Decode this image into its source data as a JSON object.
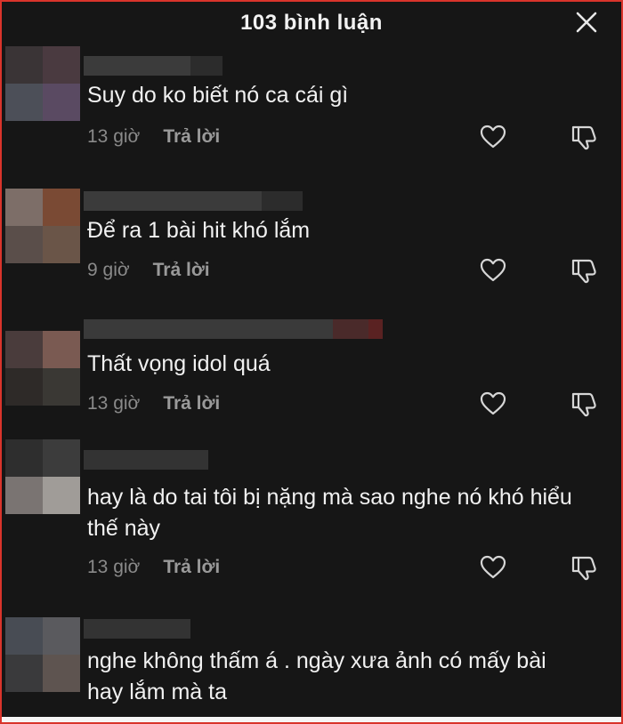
{
  "header": {
    "title": "103 bình luận",
    "close_icon": "close-icon"
  },
  "comments": [
    {
      "text": "Suy do ko biết nó ca cái gì",
      "time": "13 giờ",
      "reply": "Trả lời"
    },
    {
      "text": "Để ra 1 bài hit khó lắm",
      "time": "9 giờ",
      "reply": "Trả lời"
    },
    {
      "text": "Thất vọng idol quá",
      "time": "13 giờ",
      "reply": "Trả lời"
    },
    {
      "text": "hay là do tai tôi bị nặng mà sao nghe nó khó hiểu thế này",
      "time": "13 giờ",
      "reply": "Trả lời"
    },
    {
      "text": "nghe không thấm á . ngày xưa ảnh có mấy bài hay lắm mà ta"
    }
  ],
  "icons": {
    "like": "heart-icon",
    "dislike": "thumbs-down-icon"
  },
  "colors": {
    "background": "#161616",
    "text": "#f1f1f1",
    "meta": "#8a8a8a",
    "frame_border": "#d9342b"
  }
}
